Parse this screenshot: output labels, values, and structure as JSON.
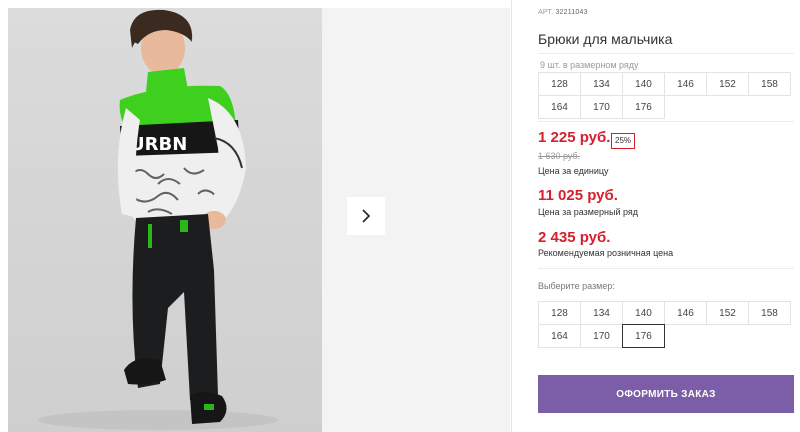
{
  "product": {
    "article_label": "АРТ.",
    "article_number": "32211043",
    "title": "Брюки для мальчика"
  },
  "size_row": {
    "note": "9 шт. в размерном ряду",
    "sizes": [
      "128",
      "134",
      "140",
      "146",
      "152",
      "158",
      "164",
      "170",
      "176"
    ]
  },
  "pricing": {
    "unit_price": "1 225 руб.",
    "discount": "25%",
    "old_price": "1 630 руб.",
    "unit_caption": "Цена за единицу",
    "row_price": "11 025 руб.",
    "row_caption": "Цена за размерный ряд",
    "retail_price": "2 435 руб.",
    "retail_caption": "Рекомендуемая розничная цена"
  },
  "size_picker": {
    "label": "Выберите размер:",
    "sizes": [
      "128",
      "134",
      "140",
      "146",
      "152",
      "158",
      "164",
      "170",
      "176"
    ],
    "selected": "176"
  },
  "order": {
    "button_label": "ОФОРМИТЬ ЗАКАЗ"
  },
  "photo": {
    "sweater_print": "URBN"
  },
  "colors": {
    "accent": "#7b5ea7",
    "price": "#d61f2c",
    "sweater_green": "#3fcf1f"
  }
}
